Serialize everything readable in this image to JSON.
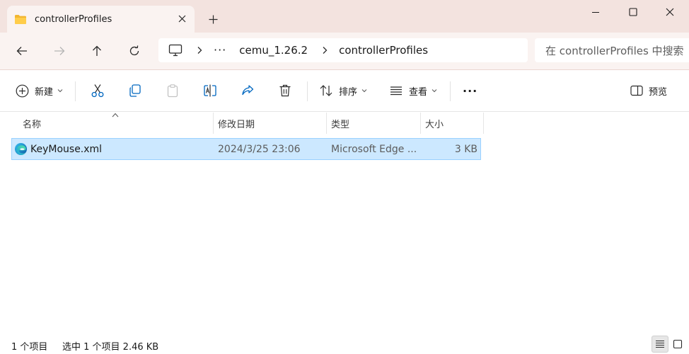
{
  "window": {
    "tab_title": "controllerProfiles",
    "new_tab_symbol": "+"
  },
  "nav": {
    "breadcrumb_ellipsis": "···",
    "breadcrumbs": [
      "cemu_1.26.2",
      "controllerProfiles"
    ],
    "search_placeholder": "在 controllerProfiles 中搜索"
  },
  "toolbar": {
    "new_label": "新建",
    "sort_label": "排序",
    "view_label": "查看",
    "more_label": "···",
    "preview_label": "预览"
  },
  "columns": [
    "名称",
    "修改日期",
    "类型",
    "大小"
  ],
  "files": [
    {
      "name": "KeyMouse.xml",
      "modified": "2024/3/25 23:06",
      "type": "Microsoft Edge ...",
      "size": "3 KB",
      "icon": "edge-icon",
      "selected": true
    }
  ],
  "status": {
    "item_count": "1 个项目",
    "selection": "选中 1 个项目  2.46 KB"
  },
  "colors": {
    "titlebar_bg": "#f3e3df",
    "navbar_bg": "#faf3f1",
    "selection_bg": "#cce8ff",
    "selection_border": "#99d1ff",
    "accent": "#0067c0"
  }
}
